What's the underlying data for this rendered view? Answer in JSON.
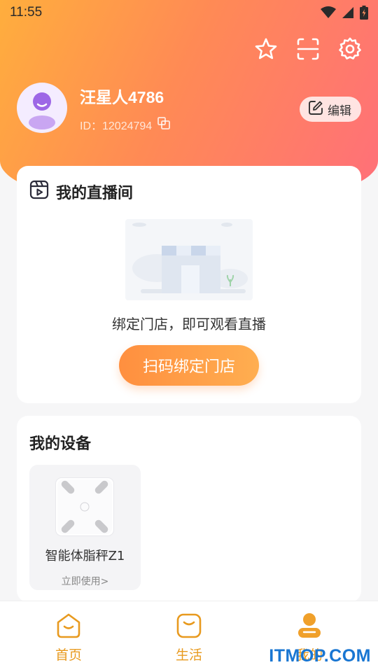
{
  "status_bar": {
    "time": "11:55",
    "icons": [
      "wifi-icon",
      "signal-icon",
      "battery-icon"
    ]
  },
  "header": {
    "actions": [
      "star-icon",
      "scan-icon",
      "settings-icon"
    ],
    "profile": {
      "name": "汪星人4786",
      "id_text": "ID：12024794",
      "edit_label": "编辑"
    }
  },
  "live_room": {
    "title": "我的直播间",
    "hint": "绑定门店，即可观看直播",
    "button_label": "扫码绑定门店"
  },
  "devices": {
    "title": "我的设备",
    "items": [
      {
        "name": "智能体脂秤Z1",
        "action": "立即使用>"
      }
    ]
  },
  "tabbar": {
    "tabs": [
      {
        "label": "首页",
        "icon": "home-face-icon"
      },
      {
        "label": "生活",
        "icon": "life-face-icon"
      },
      {
        "label": "我的",
        "icon": "mine-person-icon"
      }
    ]
  },
  "watermark": "ITMOP.COM",
  "colors": {
    "accent": "#ff8f3f",
    "tab_active": "#e89a1f",
    "header_start": "#ffae3d",
    "header_end": "#ff6f7a"
  }
}
